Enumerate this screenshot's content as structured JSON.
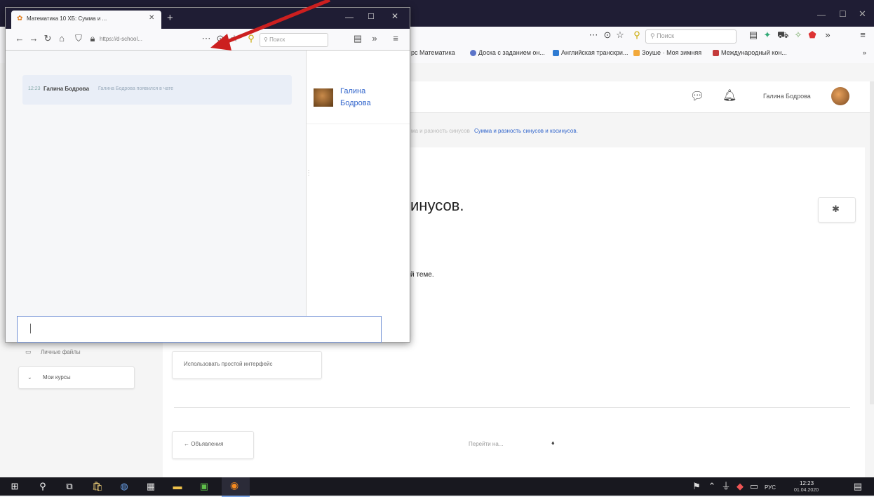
{
  "background_browser": {
    "search_placeholder": "Поиск",
    "bookmarks": [
      {
        "label": "рс Математика",
        "color": "#f7d54a"
      },
      {
        "label": "Доска с заданием он...",
        "color": "#5b74c9"
      },
      {
        "label": "Английская транскри...",
        "color": "#2f7bd2"
      },
      {
        "label": "Зоуше · Моя зимняя",
        "color": "#f2a93b"
      },
      {
        "label": "Международный кон...",
        "color": "#c43b3b"
      }
    ],
    "user_name": "Галина Бодрова",
    "breadcrumb_tail": "Сумма и разность синусов и косинусов.",
    "breadcrumb_faded": "ма и разность синусов",
    "page_heading_fragment": "инусов.",
    "text_fragment": "й теме.",
    "sidebar": {
      "private_files": "Личные файлы",
      "my_courses": "Мои курсы"
    },
    "simple_interface_button": "Использовать простой интерфейс",
    "prev_link": "← Объявления",
    "jump_to": "Перейти на...",
    "jump_arrow": "♦"
  },
  "popup": {
    "tab_title": "Математика 10 ХБ: Сумма и ...",
    "url": "https://d-school...",
    "search_placeholder": "Поиск",
    "chat_message": {
      "time": "12:23",
      "author": "Галина Бодрова",
      "text": "Галина Бодрова появился в чате"
    },
    "participant_name": "Галина Бодрова"
  },
  "taskbar": {
    "lang": "РУС",
    "time": "12:23",
    "date": "01.04.2020"
  },
  "colors": {
    "titlebar": "#1f1d34",
    "accent": "#3366cc",
    "arrow": "#cc1f1f"
  }
}
